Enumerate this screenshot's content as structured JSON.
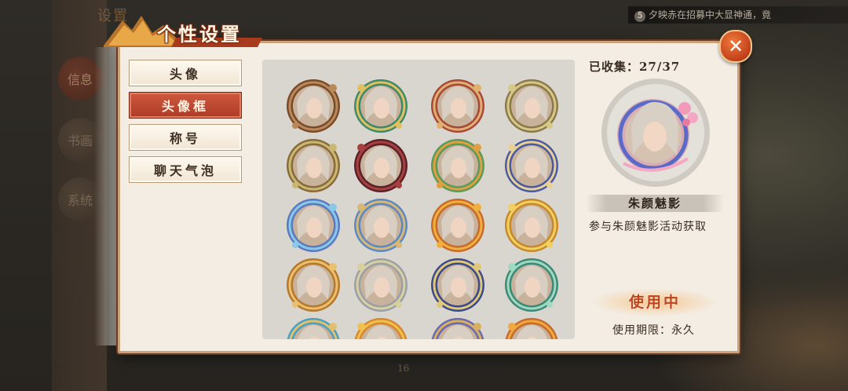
{
  "background": {
    "title": "设置",
    "side_buttons": [
      "信息",
      "书画",
      "系统"
    ],
    "notice_badge": "5",
    "notice_text": "夕映赤在招募中大显神通，竟",
    "page_number": "16"
  },
  "window": {
    "title": "个性设置",
    "close_icon": "close-icon"
  },
  "tabs": [
    {
      "label": "头像",
      "active": false
    },
    {
      "label": "头像框",
      "active": true
    },
    {
      "label": "称号",
      "active": false
    },
    {
      "label": "聊天气泡",
      "active": false
    }
  ],
  "frames": [
    {
      "ring": "#7a4a2a",
      "accent": "#b88a5a"
    },
    {
      "ring": "#3d8a6a",
      "accent": "#e0c060"
    },
    {
      "ring": "#a8483a",
      "accent": "#e0b070"
    },
    {
      "ring": "#8a7a4a",
      "accent": "#d8c888"
    },
    {
      "ring": "#8a6a3a",
      "accent": "#c8b870"
    },
    {
      "ring": "#5a2228",
      "accent": "#a84040"
    },
    {
      "ring": "#5a9a5a",
      "accent": "#e0a040"
    },
    {
      "ring": "#4a5aa0",
      "accent": "#e8d098"
    },
    {
      "ring": "#5a7ac0",
      "accent": "#8ac8e8"
    },
    {
      "ring": "#5a88c0",
      "accent": "#d8b878"
    },
    {
      "ring": "#c86a2a",
      "accent": "#f0b040"
    },
    {
      "ring": "#c8882a",
      "accent": "#f0d060"
    },
    {
      "ring": "#b8782a",
      "accent": "#e8c070"
    },
    {
      "ring": "#9aa0a8",
      "accent": "#d8d0a0"
    },
    {
      "ring": "#3a4a8a",
      "accent": "#e0c878"
    },
    {
      "ring": "#3a8a7a",
      "accent": "#a0d8c0"
    },
    {
      "ring": "#4aa0c0",
      "accent": "#e0c070"
    },
    {
      "ring": "#d8882a",
      "accent": "#f0c050"
    },
    {
      "ring": "#6a6ab0",
      "accent": "#d8b060"
    },
    {
      "ring": "#c86a2a",
      "accent": "#f0a840"
    }
  ],
  "details": {
    "collected_label": "已收集：27/37",
    "item_name": "朱颜魅影",
    "item_desc": "参与朱颜魅影活动获取",
    "status": "使用中",
    "expiry": "使用期限：永久"
  }
}
